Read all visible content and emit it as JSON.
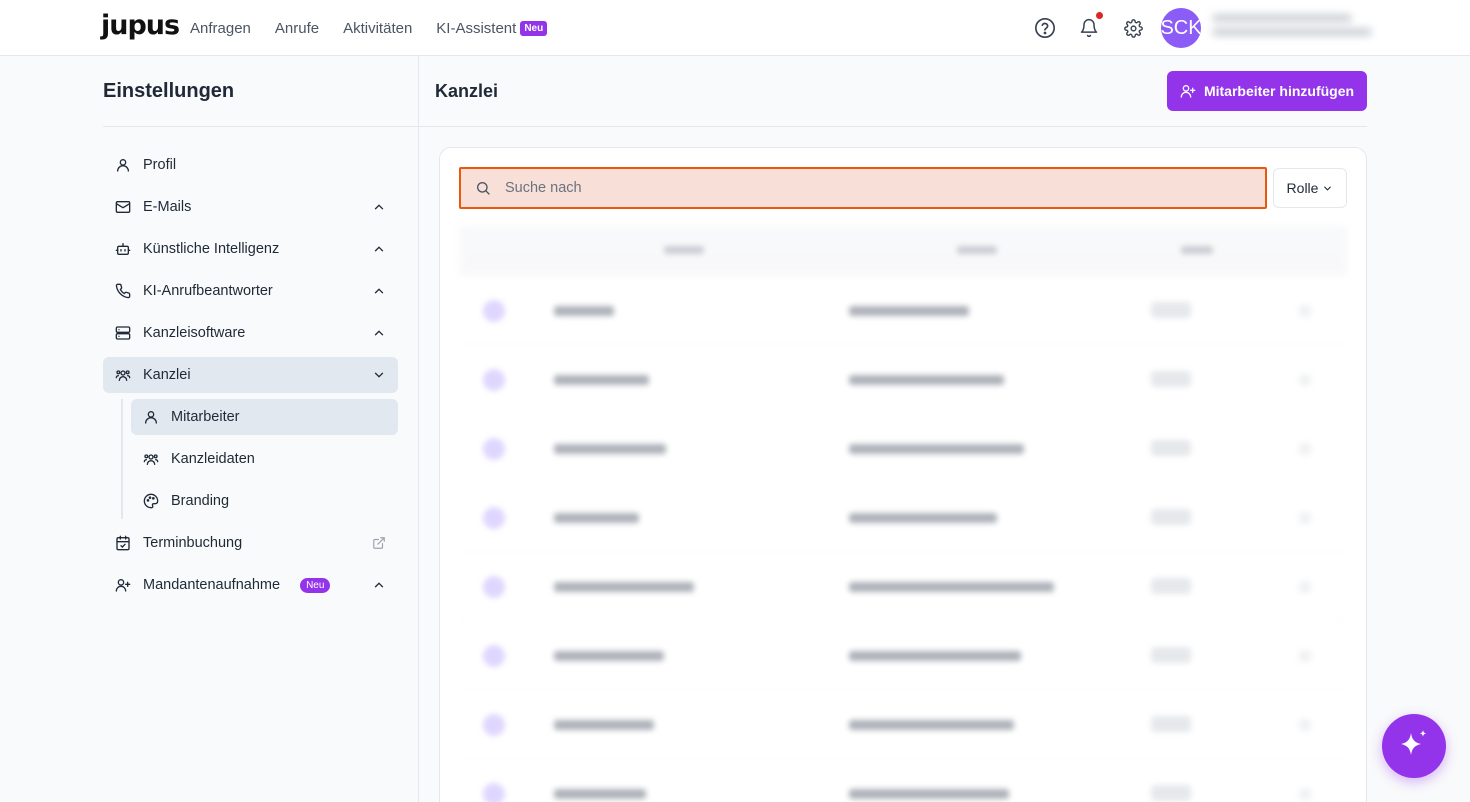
{
  "app": {
    "logo": "jupus"
  },
  "nav": {
    "items": [
      {
        "label": "Anfragen"
      },
      {
        "label": "Anrufe"
      },
      {
        "label": "Aktivitäten"
      },
      {
        "label": "KI-Assistent",
        "badge": "Neu"
      }
    ]
  },
  "user": {
    "initials": "SCK"
  },
  "sidebar": {
    "title": "Einstellungen",
    "items": [
      {
        "label": "Profil",
        "icon": "user-icon"
      },
      {
        "label": "E-Mails",
        "icon": "mail-icon"
      },
      {
        "label": "Künstliche Intelligenz",
        "icon": "bot-icon"
      },
      {
        "label": "KI-Anrufbeantworter",
        "icon": "phone-icon"
      },
      {
        "label": "Kanzleisoftware",
        "icon": "server-icon"
      },
      {
        "label": "Kanzlei",
        "icon": "users-icon"
      },
      {
        "label": "Terminbuchung",
        "icon": "calendar-check-icon"
      },
      {
        "label": "Mandantenaufnahme",
        "icon": "user-plus-icon",
        "badge": "Neu"
      }
    ],
    "sub_items": [
      {
        "label": "Mitarbeiter",
        "icon": "user-icon"
      },
      {
        "label": "Kanzleidaten",
        "icon": "users-icon"
      },
      {
        "label": "Branding",
        "icon": "palette-icon"
      }
    ]
  },
  "main": {
    "title": "Kanzlei",
    "add_button": "Mitarbeiter hinzufügen",
    "search_placeholder": "Suche nach",
    "role_filter": "Rolle"
  },
  "colors": {
    "accent": "#9333ea",
    "search_focus": "#ea580c",
    "notification": "#dc2626"
  }
}
